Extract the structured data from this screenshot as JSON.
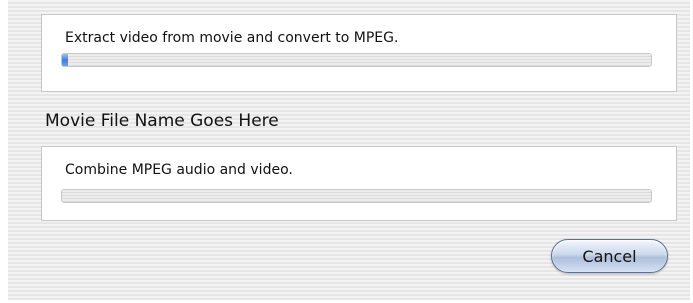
{
  "tasks": [
    {
      "label": "Extract video from movie and convert to MPEG.",
      "progress_percent": 1
    },
    {
      "label": "Combine MPEG audio and video.",
      "progress_percent": 0
    }
  ],
  "movie_file_name": "Movie File Name Goes Here",
  "buttons": {
    "cancel_label": "Cancel"
  },
  "colors": {
    "progress_fill": "#3e7fdc",
    "cancel_button": "#aebfdc"
  }
}
